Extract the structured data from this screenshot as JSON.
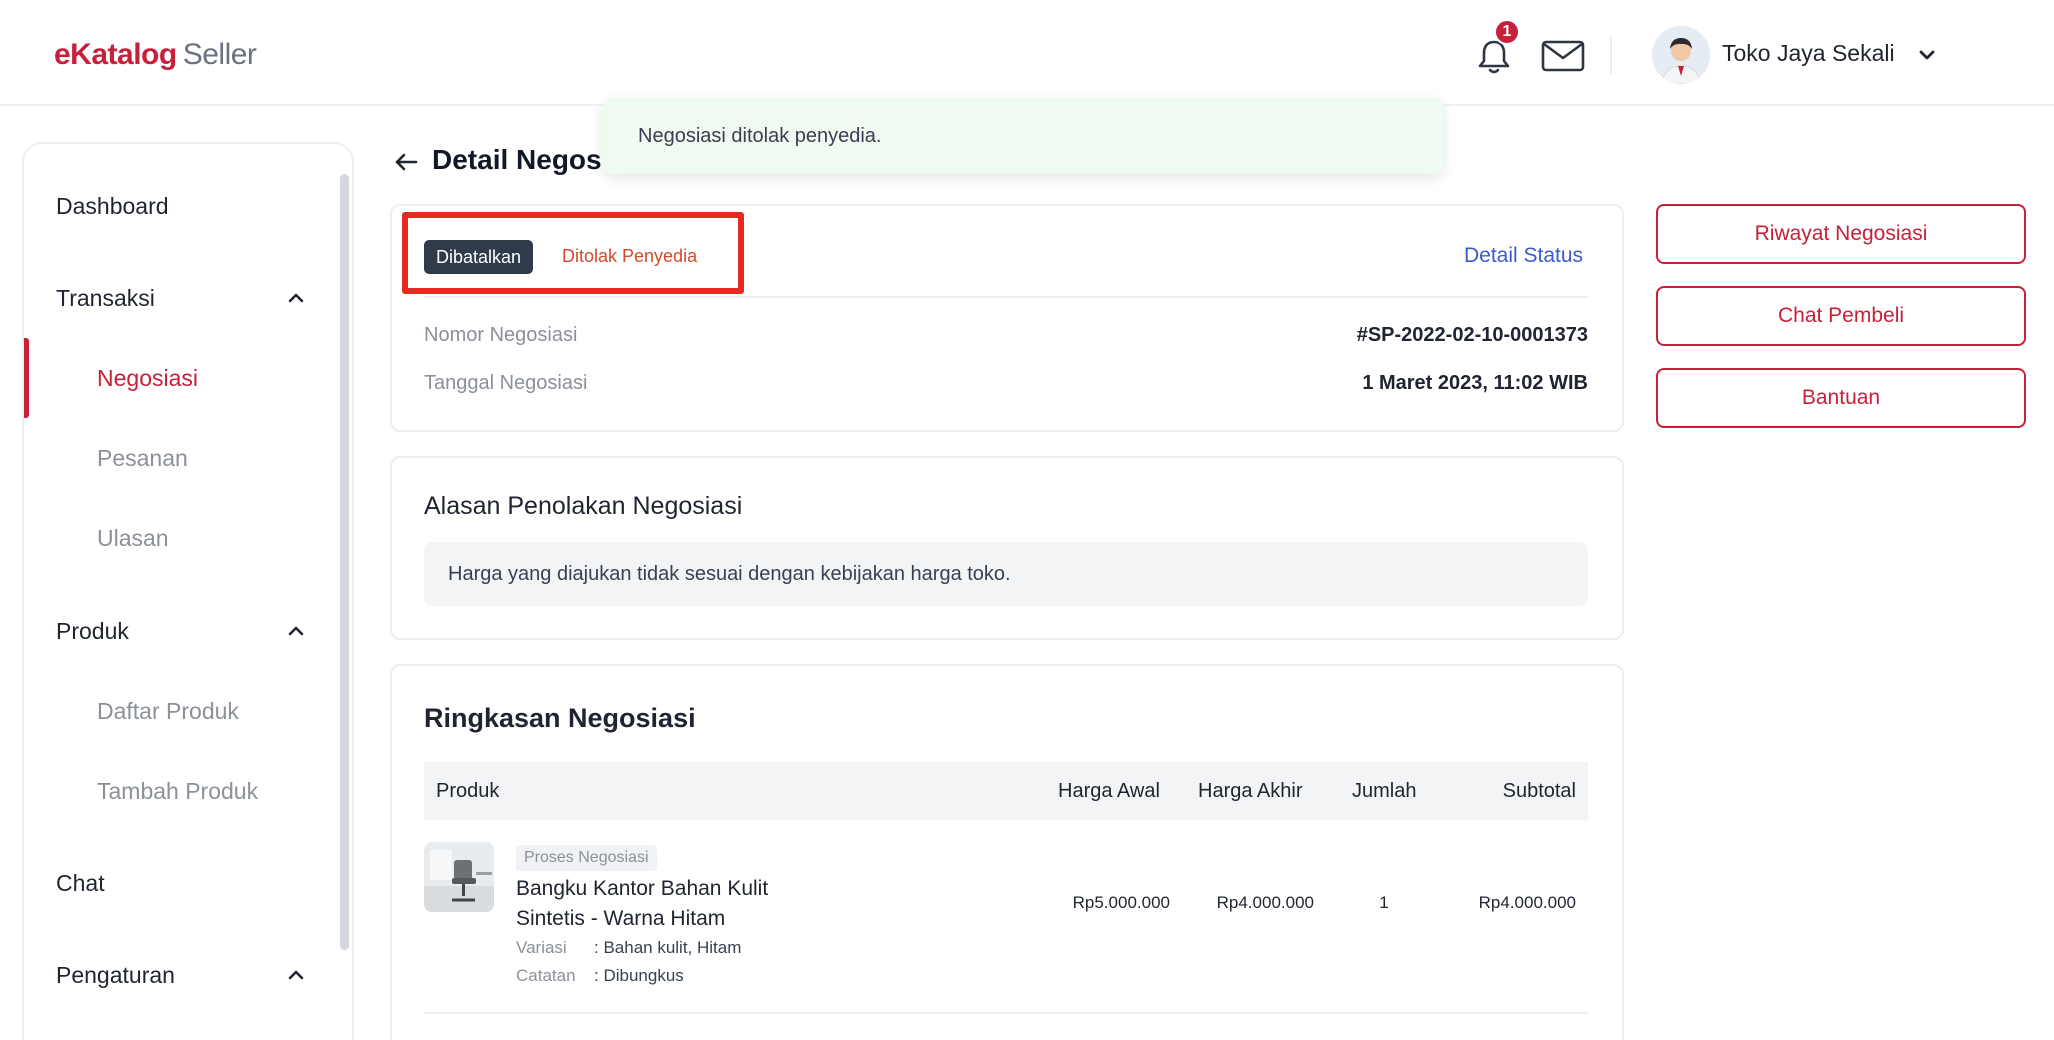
{
  "header": {
    "logo_brand": "eKatalog",
    "logo_sub": "Seller",
    "notification_count": "1",
    "username": "Toko Jaya Sekali"
  },
  "toast": {
    "message": "Negosiasi ditolak penyedia."
  },
  "sidebar": {
    "items": [
      {
        "label": "Dashboard",
        "type": "group"
      },
      {
        "label": "Transaksi",
        "type": "group",
        "expanded": true
      },
      {
        "label": "Negosiasi",
        "type": "child",
        "active": true
      },
      {
        "label": "Pesanan",
        "type": "child"
      },
      {
        "label": "Ulasan",
        "type": "child"
      },
      {
        "label": "Produk",
        "type": "group",
        "expanded": true
      },
      {
        "label": "Daftar Produk",
        "type": "child"
      },
      {
        "label": "Tambah Produk",
        "type": "child"
      },
      {
        "label": "Chat",
        "type": "group"
      },
      {
        "label": "Pengaturan",
        "type": "group",
        "expanded": true
      }
    ]
  },
  "page": {
    "title": "Detail Negosi"
  },
  "status": {
    "badge": "Dibatalkan",
    "sub": "Ditolak Penyedia",
    "detail_link": "Detail Status"
  },
  "info": {
    "nomor_label": "Nomor Negosiasi",
    "nomor_value": "#SP-2022-02-10-0001373",
    "tanggal_label": "Tanggal Negosiasi",
    "tanggal_value": "1 Maret 2023, 11:02 WIB"
  },
  "reason": {
    "title": "Alasan Penolakan Negosiasi",
    "text": "Harga yang diajukan tidak sesuai dengan kebijakan harga toko."
  },
  "summary": {
    "title": "Ringkasan Negosiasi",
    "columns": [
      "Produk",
      "Harga Awal",
      "Harga Akhir",
      "Jumlah",
      "Subtotal"
    ],
    "rows": [
      {
        "badge": "Proses Negosiasi",
        "name": "Bangku Kantor Bahan Kulit Sintetis - Warna Hitam",
        "variasi_label": "Variasi",
        "variasi_value": ": Bahan kulit, Hitam",
        "catatan_label": "Catatan",
        "catatan_value": ": Dibungkus",
        "harga_awal": "Rp5.000.000",
        "harga_akhir": "Rp4.000.000",
        "jumlah": "1",
        "subtotal": "Rp4.000.000"
      }
    ]
  },
  "actions": {
    "riwayat": "Riwayat Negosiasi",
    "chat": "Chat Pembeli",
    "bantuan": "Bantuan"
  },
  "colors": {
    "brand": "#c7203b",
    "link": "#3b5bc7",
    "toast_bg": "#effaf1",
    "highlight": "#e32b23"
  }
}
